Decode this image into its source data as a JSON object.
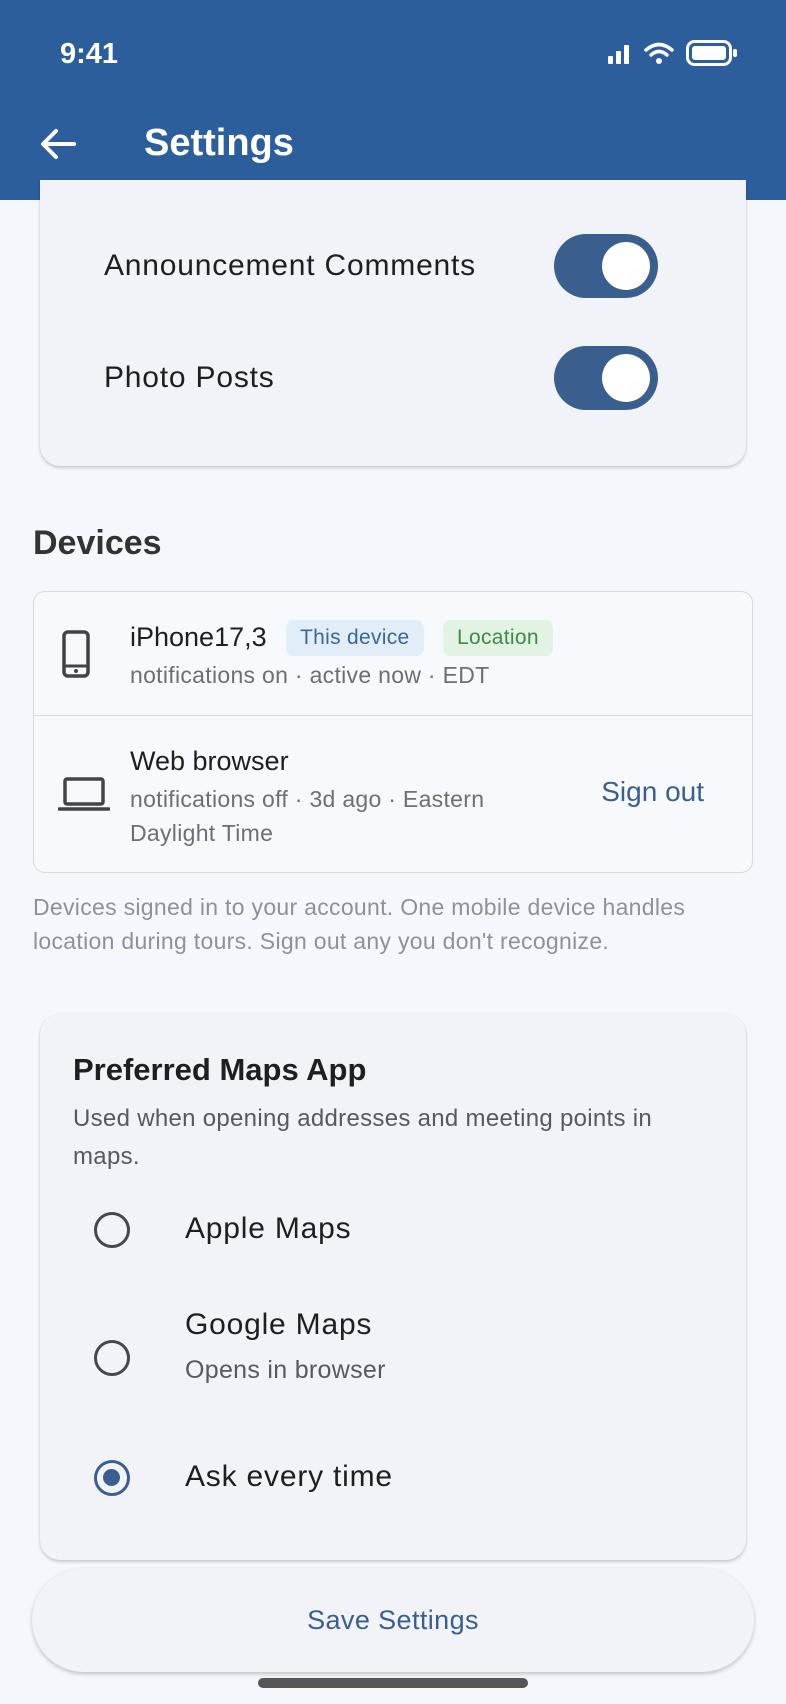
{
  "status_bar": {
    "time": "9:41"
  },
  "header": {
    "title": "Settings"
  },
  "notifications": [
    {
      "label": "Announcement Comments",
      "enabled": true
    },
    {
      "label": "Photo Posts",
      "enabled": true
    }
  ],
  "devices": {
    "title": "Devices",
    "items": [
      {
        "name": "iPhone17,3",
        "badges": [
          "This device",
          "Location"
        ],
        "meta": "notifications on · active now · EDT"
      },
      {
        "name": "Web browser",
        "meta_line1": "notifications off · 3d ago · Eastern",
        "meta_line2": "Daylight Time",
        "action": "Sign out"
      }
    ],
    "helper": "Devices signed in to your account. One mobile device handles location during tours. Sign out any you don't recognize."
  },
  "maps": {
    "title": "Preferred Maps App",
    "description": "Used when opening addresses and meeting points in maps.",
    "options": [
      {
        "label": "Apple Maps",
        "sub": "",
        "selected": false
      },
      {
        "label": "Google Maps",
        "sub": "Opens in browser",
        "selected": false
      },
      {
        "label": "Ask every time",
        "sub": "",
        "selected": true
      }
    ]
  },
  "save_label": "Save Settings",
  "colors": {
    "header": "#2c5e9c",
    "accent": "#3a5f8f",
    "badge_this_bg": "#e1eef9",
    "badge_location_bg": "#e3f3e3"
  }
}
